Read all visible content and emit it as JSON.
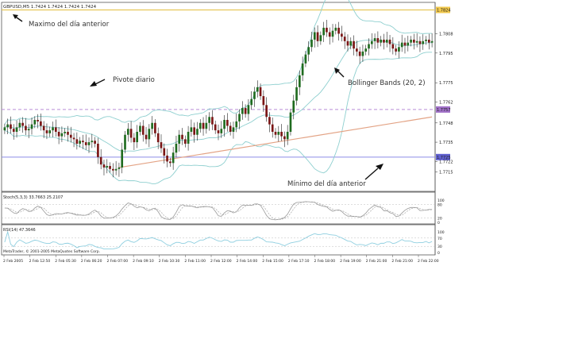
{
  "header": {
    "symbol_line": "GBPUSD,M5  1.7424 1.7424 1.7424 1.7424",
    "stoch_line": "Stoch(5,3,3) 33.7663 25.2107",
    "rsi_line": "RSI(14) 47.3646",
    "copyright": "MetaTrader, © 2001-2005 MetaQuotes Software Corp."
  },
  "annotations": {
    "prev_high": "Maximo del día anterior",
    "pivot": "Pivote diario",
    "bollinger": "Bollinger Bands (20, 2)",
    "prev_low": "Mínimo del día anterior"
  },
  "colors": {
    "candle_up": "#1f6b1f",
    "candle_down": "#7a1515",
    "wick": "#222222",
    "bollinger": "#8ecfcf",
    "prev_high_line": "#e6c65a",
    "pivot_line": "#b98dd8",
    "prev_low_line": "#8c8ce6",
    "trend_line": "#e3a385",
    "stoch_line": "#9a9a9a",
    "rsi_line": "#8fcfe0",
    "price_tag_yellow": "#f2c94c",
    "price_tag_purple": "#a070c8",
    "price_tag_blue": "#6060d0"
  },
  "chart_data": {
    "type": "candlestick",
    "symbol": "GBPUSD",
    "timeframe": "M5",
    "x_tick_labels": [
      "2 Feb 2005",
      "2 Feb 12:50",
      "2 Feb 05:30",
      "2 Feb 06:20",
      "2 Feb 07:00",
      "2 Feb 09:10",
      "2 Feb 10:30",
      "2 Feb 11:00",
      "2 Feb 12:00",
      "2 Feb 14:00",
      "2 Feb 15:00",
      "2 Feb 17:10",
      "2 Feb 18:00",
      "2 Feb 19:00",
      "2 Feb 21:00",
      "2 Feb 21:00",
      "2 Feb 22:00"
    ],
    "y_tick_labels": [
      "1.7808",
      "1.7795",
      "1.7775",
      "1.7762",
      "1.7748",
      "1.7735",
      "1.7722",
      "1.7715"
    ],
    "price_tags": {
      "prev_high": "1.7824",
      "pivot": "1.7757",
      "prev_low": "1.7725"
    },
    "ylim": [
      1.7703,
      1.7828
    ],
    "levels": {
      "prev_high": 1.7824,
      "pivot": 1.7757,
      "prev_low": 1.7725
    },
    "trend_line": {
      "start_index": 38,
      "start_price": 1.7718,
      "end_index": 142,
      "end_price": 1.7752
    },
    "close": [
      1.7745,
      1.7747,
      1.7744,
      1.7742,
      1.7745,
      1.7748,
      1.7746,
      1.7743,
      1.7744,
      1.7747,
      1.775,
      1.7749,
      1.7746,
      1.7743,
      1.7741,
      1.7743,
      1.7745,
      1.7742,
      1.7739,
      1.7741,
      1.7742,
      1.774,
      1.7738,
      1.7737,
      1.7734,
      1.7736,
      1.7735,
      1.7733,
      1.7735,
      1.7736,
      1.7734,
      1.7725,
      1.772,
      1.7718,
      1.7719,
      1.7717,
      1.7716,
      1.7717,
      1.7718,
      1.773,
      1.774,
      1.7744,
      1.7738,
      1.7735,
      1.7742,
      1.7746,
      1.774,
      1.7737,
      1.7744,
      1.7748,
      1.7741,
      1.7735,
      1.7731,
      1.7726,
      1.7722,
      1.7721,
      1.7728,
      1.7734,
      1.774,
      1.7737,
      1.7734,
      1.7742,
      1.7745,
      1.774,
      1.7744,
      1.7748,
      1.7744,
      1.7748,
      1.7752,
      1.7747,
      1.7743,
      1.7741,
      1.7744,
      1.775,
      1.7746,
      1.7742,
      1.7745,
      1.7749,
      1.7754,
      1.7758,
      1.7754,
      1.776,
      1.7764,
      1.7769,
      1.7772,
      1.7766,
      1.776,
      1.7752,
      1.7747,
      1.7742,
      1.774,
      1.7742,
      1.7739,
      1.7737,
      1.7742,
      1.7755,
      1.7763,
      1.7772,
      1.778,
      1.7788,
      1.7794,
      1.7799,
      1.7804,
      1.7809,
      1.7803,
      1.7807,
      1.7812,
      1.7809,
      1.7806,
      1.781,
      1.7812,
      1.7808,
      1.7806,
      1.7803,
      1.78,
      1.7803,
      1.7798,
      1.7796,
      1.7793,
      1.7796,
      1.7798,
      1.7801,
      1.7803,
      1.7805,
      1.7802,
      1.7804,
      1.7802,
      1.7804,
      1.7801,
      1.7798,
      1.7796,
      1.7799,
      1.7802,
      1.78,
      1.7802,
      1.7804,
      1.7802,
      1.7803,
      1.7801,
      1.7803,
      1.7804,
      1.7802,
      1.7803
    ],
    "stoch_ylim": [
      0,
      100
    ],
    "stoch_levels": [
      20,
      80
    ],
    "stoch_tick_labels": [
      "100",
      "80",
      "20",
      "0"
    ],
    "rsi_ylim": [
      0,
      100
    ],
    "rsi_levels": [
      30,
      70
    ],
    "rsi_tick_labels": [
      "100",
      "70",
      "30",
      "0"
    ]
  }
}
